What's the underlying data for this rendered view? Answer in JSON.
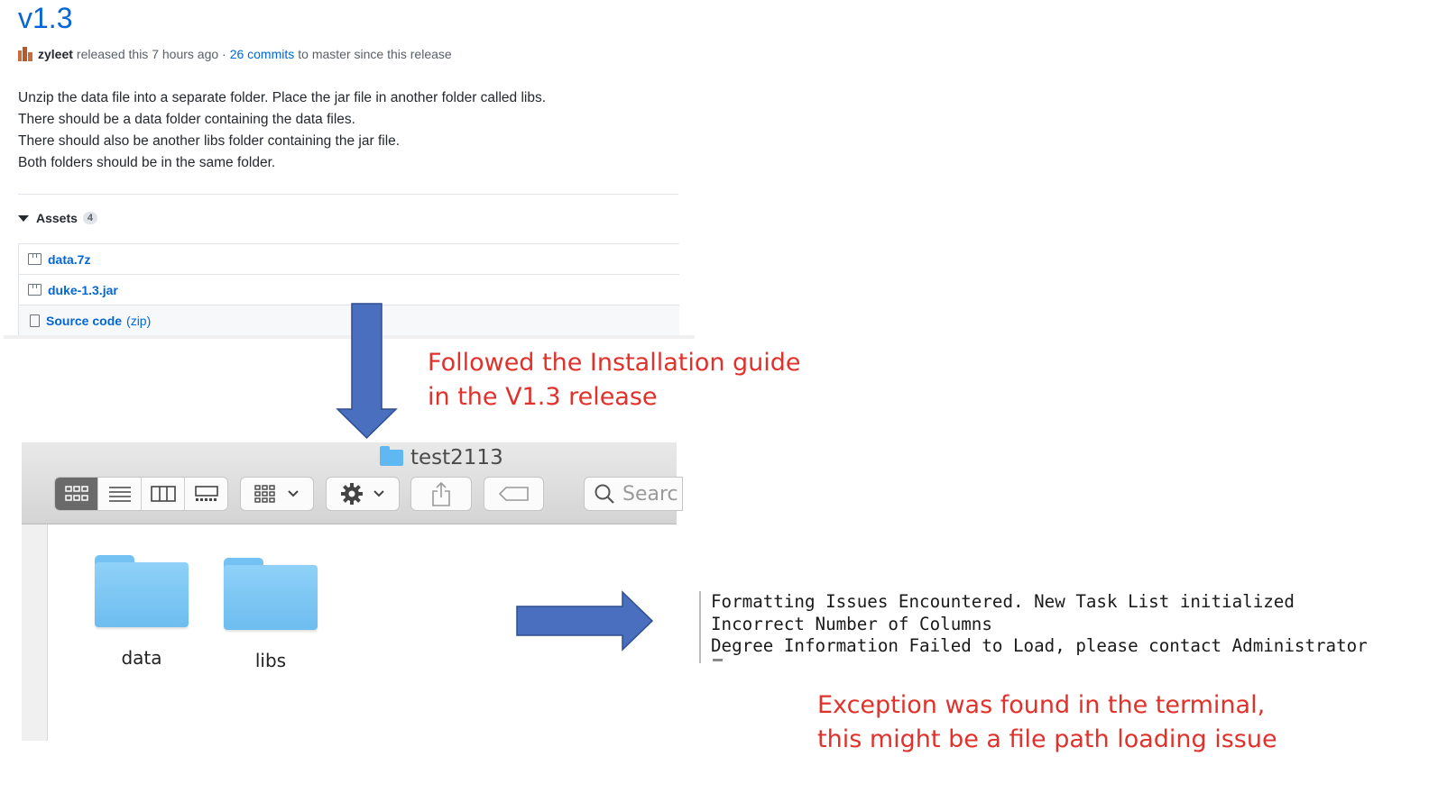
{
  "release": {
    "title": "v1.3",
    "author": "zyleet",
    "released_text": "released this 7 hours ago ·",
    "commits_link": "26 commits",
    "commits_suffix": "to master since this release",
    "description": [
      "Unzip the data file into a separate folder. Place the jar file in another folder called libs.",
      "There should be a data folder containing the data files.",
      "There should also be another libs folder containing the jar file.",
      "Both folders should be in the same folder."
    ],
    "assets_label": "Assets",
    "assets_count": "4",
    "assets": [
      {
        "name": "data.7z",
        "icon": "package-icon"
      },
      {
        "name": "duke-1.3.jar",
        "icon": "package-icon"
      },
      {
        "name": "Source code",
        "suffix": "(zip)",
        "icon": "file-zip-icon"
      }
    ]
  },
  "annotations": {
    "install_note": [
      "Followed the Installation guide",
      "in the V1.3 release"
    ],
    "exception_note": [
      "Exception was found in the terminal,",
      "this might be a file path loading issue"
    ]
  },
  "finder": {
    "window_title": "test2113",
    "search_placeholder": "Searc",
    "folders": [
      {
        "label": "data"
      },
      {
        "label": "libs"
      }
    ]
  },
  "terminal": {
    "lines": [
      "Formatting Issues Encountered. New Task List initialized",
      "Incorrect Number of Columns",
      "Degree Information Failed to Load, please contact Administrator"
    ]
  },
  "colors": {
    "link": "#0366d6",
    "annotation_red": "#e0312b",
    "arrow_blue": "#4a6fbf",
    "folder_blue": "#74c2f3"
  }
}
